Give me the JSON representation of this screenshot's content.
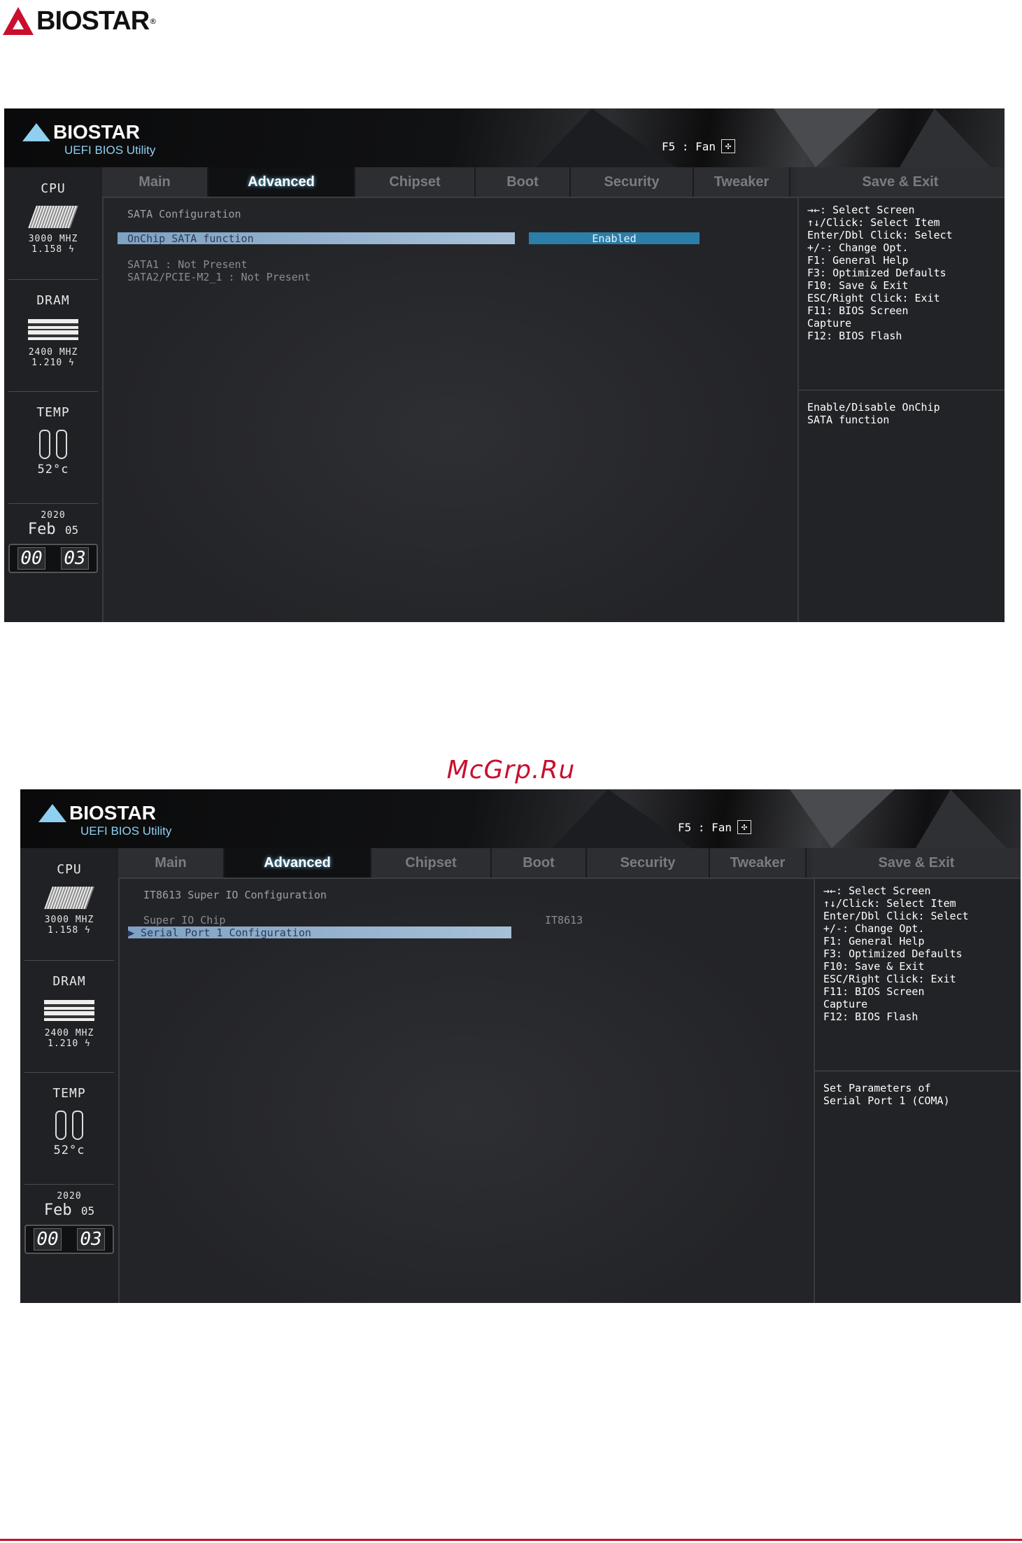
{
  "page": {
    "brand": "BIOSTAR",
    "watermark": "McGrp.Ru"
  },
  "bios": {
    "brand": "BIOSTAR",
    "subtitle": "UEFI BIOS Utility",
    "fan_hint": "F5 : Fan",
    "tabs": [
      "Main",
      "Advanced",
      "Chipset",
      "Boot",
      "Security",
      "Tweaker",
      "Save & Exit"
    ],
    "active_tab": "Advanced",
    "status": {
      "cpu_label": "CPU",
      "cpu_freq": "3000 MHZ",
      "cpu_volt": "1.158 ϟ",
      "dram_label": "DRAM",
      "dram_freq": "2400 MHZ",
      "dram_volt": "1.210 ϟ",
      "temp_label": "TEMP",
      "temp_value": "52°c",
      "year": "2020",
      "month": "Feb",
      "day": "05",
      "clock_h": "00",
      "clock_m": "03"
    },
    "help_keys": "→←: Select Screen\n↑↓/Click: Select Item\nEnter/Dbl Click: Select\n+/-: Change Opt.\nF1: General Help\nF3: Optimized Defaults\nF10: Save & Exit\nESC/Right Click: Exit\nF11: BIOS Screen\nCapture\nF12: BIOS Flash"
  },
  "screen1": {
    "title": "SATA Configuration",
    "selected_label": "OnChip SATA function",
    "selected_value": "Enabled",
    "line1": "SATA1 : Not Present",
    "line2": "SATA2/PCIE-M2_1 : Not Present",
    "help_desc": "Enable/Disable OnChip\nSATA function"
  },
  "screen2": {
    "title": "IT8613 Super IO Configuration",
    "chip_label": "Super IO Chip",
    "chip_value": "IT8613",
    "selected_label": "▶ Serial Port 1 Configuration",
    "help_desc": "Set Parameters of\nSerial Port 1 (COMA)"
  }
}
